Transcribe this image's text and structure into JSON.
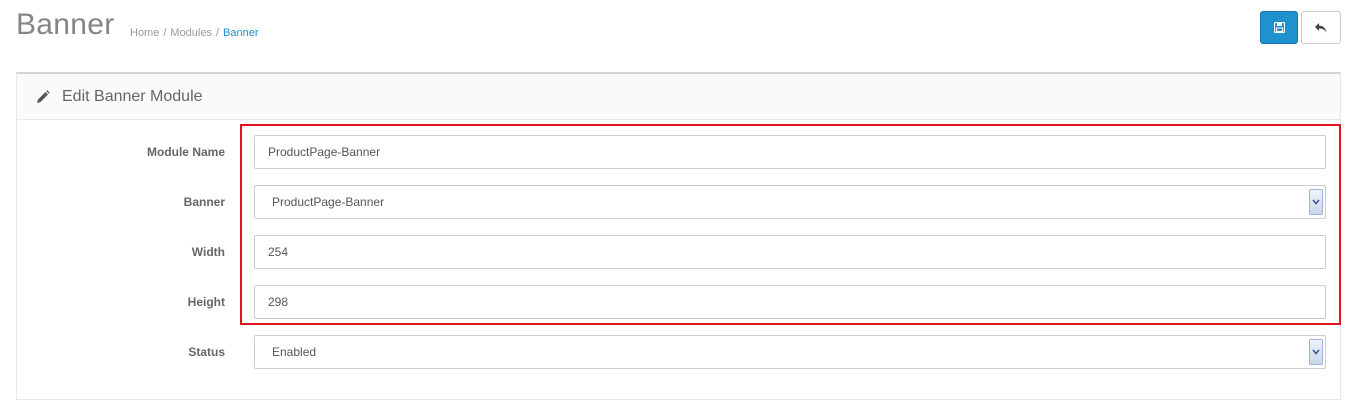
{
  "header": {
    "title": "Banner",
    "breadcrumb": [
      "Home",
      "Modules",
      "Banner"
    ],
    "save_icon": "save-icon",
    "back_icon": "reply-icon"
  },
  "panel": {
    "heading": "Edit Banner Module",
    "heading_icon": "pencil-icon"
  },
  "form": {
    "module_name": {
      "label": "Module Name",
      "value": "ProductPage-Banner"
    },
    "banner": {
      "label": "Banner",
      "value": "ProductPage-Banner"
    },
    "width": {
      "label": "Width",
      "value": "254"
    },
    "height": {
      "label": "Height",
      "value": "298"
    },
    "status": {
      "label": "Status",
      "value": "Enabled"
    }
  },
  "colors": {
    "primary": "#1e91cf",
    "highlight": "#e0141e"
  }
}
